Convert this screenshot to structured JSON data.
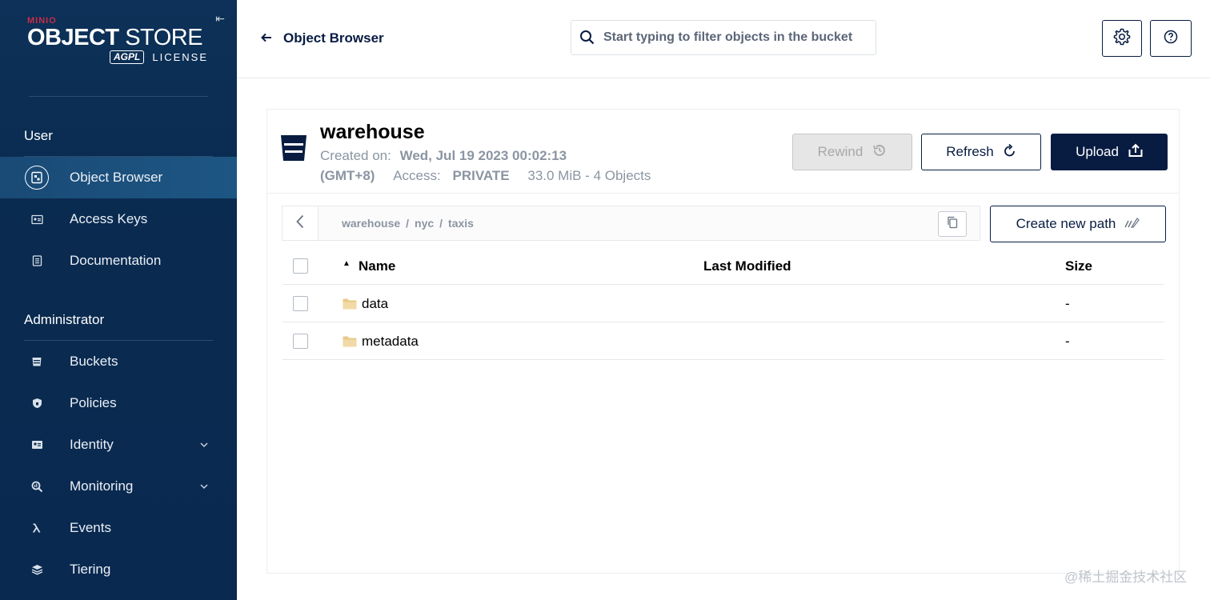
{
  "sidebar": {
    "logo": {
      "brand": "MINIO",
      "product_bold": "OBJECT",
      "product_thin": "STORE",
      "agpl": "AGPL",
      "license": "LICENSE"
    },
    "collapse_glyph": "⇤",
    "sections": [
      {
        "label": "User"
      },
      {
        "label": "Administrator"
      }
    ],
    "items": [
      {
        "label": "Object Browser",
        "icon": "object-browser-icon",
        "active": true
      },
      {
        "label": "Access Keys",
        "icon": "access-keys-icon"
      },
      {
        "label": "Documentation",
        "icon": "documentation-icon"
      },
      {
        "label": "Buckets",
        "icon": "buckets-icon"
      },
      {
        "label": "Policies",
        "icon": "policies-icon"
      },
      {
        "label": "Identity",
        "icon": "identity-icon",
        "expandable": true
      },
      {
        "label": "Monitoring",
        "icon": "monitoring-icon",
        "expandable": true
      },
      {
        "label": "Events",
        "icon": "lambda-icon"
      },
      {
        "label": "Tiering",
        "icon": "tiering-icon"
      }
    ]
  },
  "topbar": {
    "title": "Object Browser",
    "search_placeholder": "Start typing to filter objects in the bucket"
  },
  "bucket": {
    "name": "warehouse",
    "created_label": "Created on:",
    "created_value": "Wed, Jul 19 2023 00:02:13",
    "timezone": "(GMT+8)",
    "access_label": "Access:",
    "access_value": "PRIVATE",
    "usage": "33.0 MiB - 4 Objects"
  },
  "actions": {
    "rewind": "Rewind",
    "refresh": "Refresh",
    "upload": "Upload",
    "create_path": "Create new path"
  },
  "breadcrumb": [
    "warehouse",
    "nyc",
    "taxis"
  ],
  "table": {
    "headers": {
      "name": "Name",
      "modified": "Last Modified",
      "size": "Size"
    },
    "rows": [
      {
        "name": "data",
        "modified": "",
        "size": "-"
      },
      {
        "name": "metadata",
        "modified": "",
        "size": "-"
      }
    ]
  },
  "watermark": "@稀土掘金技术社区",
  "colors": {
    "sidebar_bg": "#0a2950",
    "primary": "#081c42",
    "brand_red": "#c72c48",
    "folder": "#e8c98a"
  }
}
